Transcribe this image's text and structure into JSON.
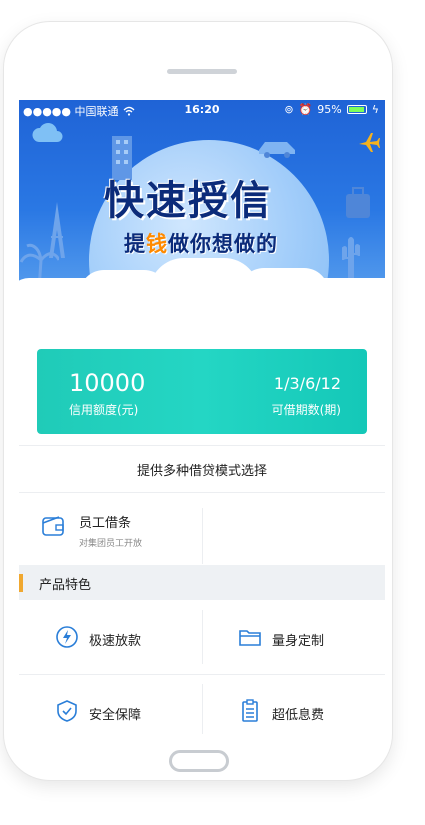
{
  "statusbar": {
    "carrier": "●●●●● 中国联通",
    "time": "16:20",
    "battery": "95%"
  },
  "banner": {
    "title": "快速授信",
    "subtitle_pre": "提",
    "subtitle_highlight": "钱",
    "subtitle_post": "做你想做的",
    "colors": {
      "sky": "#1f63d6",
      "highlight": "#ff8a00"
    }
  },
  "credit": {
    "amount": "10000",
    "amount_label": "信用额度(元)",
    "periods": "1/3/6/12",
    "periods_label": "可借期数(期)",
    "color": "#20cbb8"
  },
  "mode_text": "提供多种借贷模式选择",
  "employee_loan": {
    "title": "员工借条",
    "subtitle": "对集团员工开放",
    "icon": "wallet-icon"
  },
  "features": {
    "header": "产品特色",
    "items": [
      {
        "label": "极速放款",
        "icon": "lightning-icon"
      },
      {
        "label": "量身定制",
        "icon": "folder-icon"
      },
      {
        "label": "安全保障",
        "icon": "shield-icon"
      },
      {
        "label": "超低息费",
        "icon": "document-icon"
      }
    ],
    "accent": "#f0a830",
    "icon_color": "#2a7ed8"
  }
}
